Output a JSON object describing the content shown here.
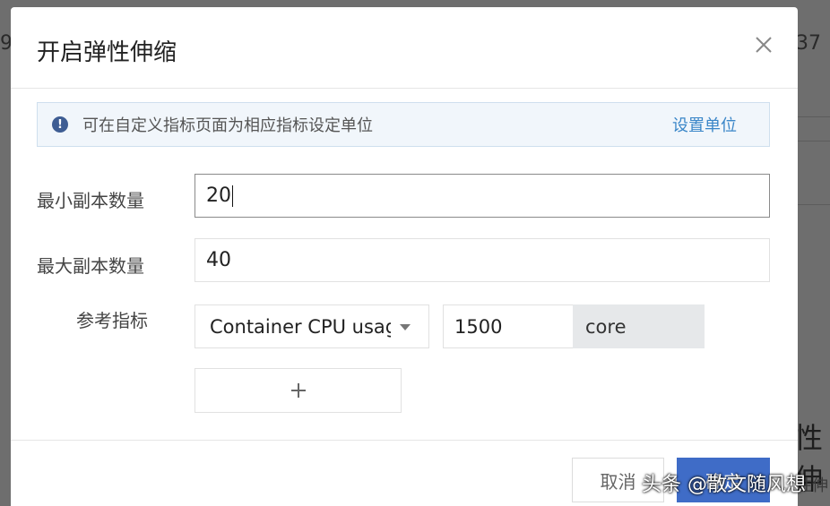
{
  "background": {
    "left_fragment": "9",
    "right_number": "37",
    "right_title_fragment": "性伸",
    "right_sub_fragment": "性伸"
  },
  "modal": {
    "title": "开启弹性伸缩",
    "close_icon": "close-icon"
  },
  "tip": {
    "icon": "info-icon",
    "text": "可在自定义指标页面为相应指标设定单位",
    "link": "设置单位"
  },
  "form": {
    "min_replicas": {
      "label": "最小副本数量",
      "value": "20"
    },
    "max_replicas": {
      "label": "最大副本数量",
      "value": "40"
    },
    "metric": {
      "label": "参考指标",
      "selected": "Container CPU usage",
      "value": "1500",
      "unit": "core"
    },
    "add_icon": "plus-icon"
  },
  "footer": {
    "cancel": "取消",
    "confirm": "确定"
  },
  "watermark": "头条 @散文随风想",
  "colors": {
    "primary": "#3f6cc7",
    "link": "#3a86c8",
    "tip_bg": "#f1f6fb"
  }
}
